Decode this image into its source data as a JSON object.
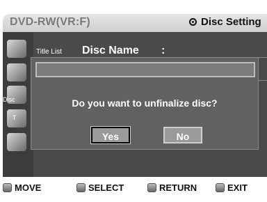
{
  "header": {
    "device": "DVD-RW(VR:F)",
    "title": "Disc Setting"
  },
  "sidebar": {
    "items": [
      {
        "label": "Title List",
        "icon": "title-list-icon"
      },
      {
        "label": "",
        "icon": "playlist-icon"
      },
      {
        "label": "Disc",
        "icon": "disc-manager-icon"
      },
      {
        "label": "T",
        "icon": "timer-record-icon"
      },
      {
        "label": "",
        "icon": "setup-icon"
      }
    ]
  },
  "content": {
    "disc_name_label": "Disc Name",
    "colon": ":"
  },
  "dialog": {
    "message": "Do you want to unfinalize disc?",
    "yes_label": "Yes",
    "no_label": "No"
  },
  "footer": [
    {
      "label": "MOVE",
      "icon": "move-icon"
    },
    {
      "label": "SELECT",
      "icon": "select-icon"
    },
    {
      "label": "RETURN",
      "icon": "return-icon"
    },
    {
      "label": "EXIT",
      "icon": "exit-icon"
    }
  ]
}
